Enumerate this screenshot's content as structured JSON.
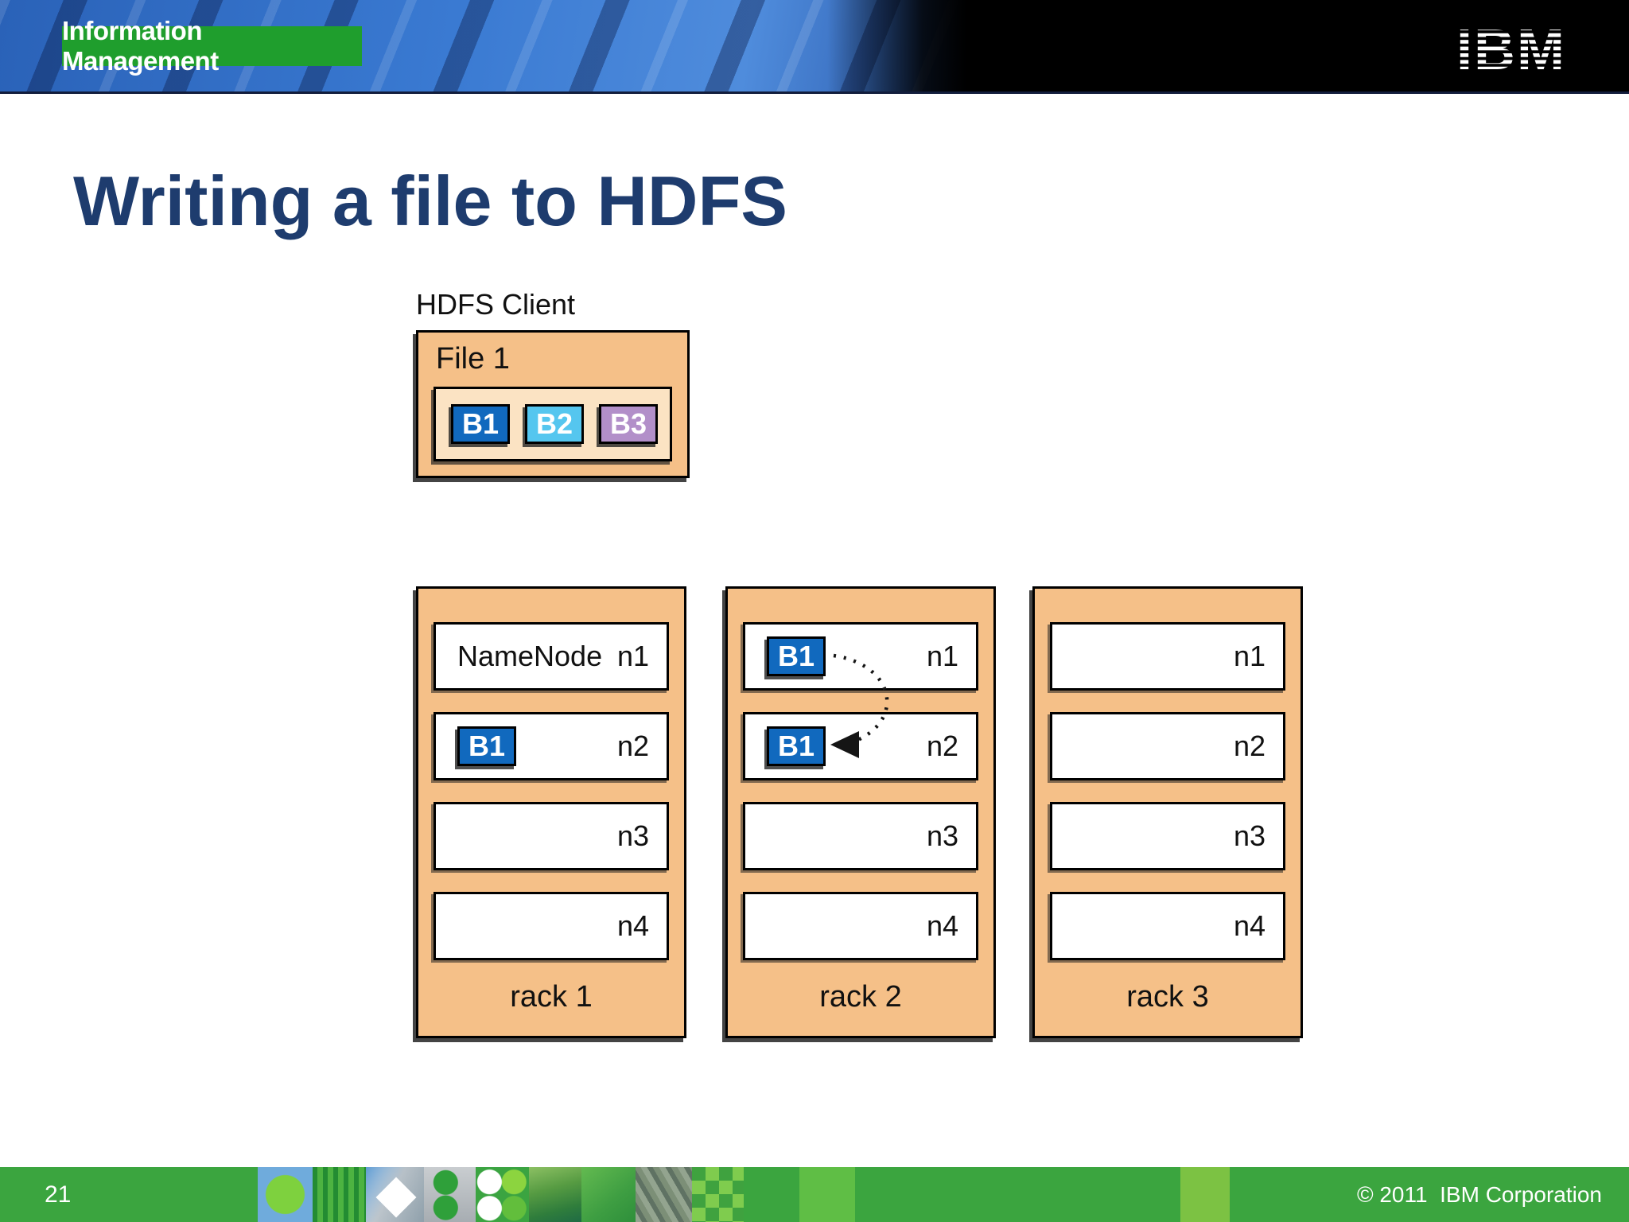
{
  "header": {
    "brand_label": "Information Management",
    "logo": "IBM"
  },
  "title": "Writing a file to HDFS",
  "diagram": {
    "client": {
      "label": "HDFS Client",
      "file_label": "File 1",
      "blocks": [
        {
          "label": "B1",
          "color": "#1169BE"
        },
        {
          "label": "B2",
          "color": "#55C6EF"
        },
        {
          "label": "B3",
          "color": "#B28FC9"
        }
      ]
    },
    "racks": [
      {
        "name": "rack 1",
        "nodes": [
          {
            "id": "n1",
            "text": "NameNode"
          },
          {
            "id": "n2",
            "block": "B1"
          },
          {
            "id": "n3"
          },
          {
            "id": "n4"
          }
        ]
      },
      {
        "name": "rack 2",
        "nodes": [
          {
            "id": "n1",
            "block": "B1"
          },
          {
            "id": "n2",
            "block": "B1"
          },
          {
            "id": "n3"
          },
          {
            "id": "n4"
          }
        ]
      },
      {
        "name": "rack 3",
        "nodes": [
          {
            "id": "n1"
          },
          {
            "id": "n2"
          },
          {
            "id": "n3"
          },
          {
            "id": "n4"
          }
        ]
      }
    ],
    "colors": {
      "rack_fill": "#F5C088",
      "file_inner_fill": "#FBE3C3",
      "block_blue": "#1169BE",
      "block_cyan": "#55C6EF",
      "block_purple": "#B28FC9"
    }
  },
  "footer": {
    "page_number": "21",
    "copyright": "© 2011  IBM Corporation",
    "bar_color": "#3BA53F"
  },
  "colors": {
    "title_navy": "#1E3C6E",
    "brand_green": "#1F9E2D"
  }
}
